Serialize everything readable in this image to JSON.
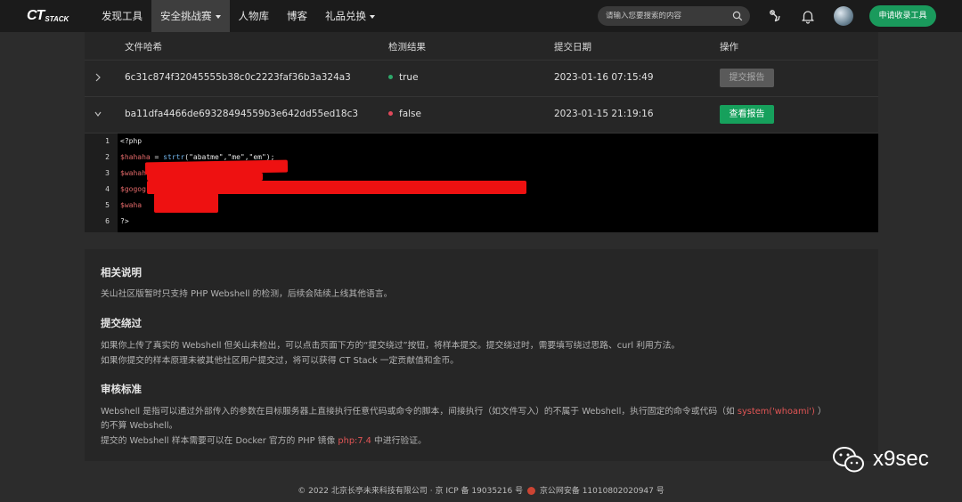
{
  "brand": {
    "mark": "CT",
    "sub": "STACK"
  },
  "nav": [
    {
      "label": "发现工具",
      "active": false,
      "dropdown": false
    },
    {
      "label": "安全挑战赛",
      "active": true,
      "dropdown": true
    },
    {
      "label": "人物库",
      "active": false,
      "dropdown": false
    },
    {
      "label": "博客",
      "active": false,
      "dropdown": false
    },
    {
      "label": "礼品兑换",
      "active": false,
      "dropdown": true
    }
  ],
  "search": {
    "placeholder": "请输入您要搜索的内容"
  },
  "header": {
    "apply_button": "申请收录工具"
  },
  "table": {
    "columns": [
      "文件哈希",
      "检测结果",
      "提交日期",
      "操作"
    ],
    "rows": [
      {
        "hash": "6c31c874f32045555b38c0c2223faf36b3a324a3",
        "result": "true",
        "result_color": "#2ea86a",
        "date": "2023-01-16 07:15:49",
        "action": "提交报告",
        "expanded": false
      },
      {
        "hash": "ba11dfa4466de69328494559b3e642dd55ed18c3",
        "result": "false",
        "result_color": "#e0485a",
        "date": "2023-01-15 21:19:16",
        "action": "查看报告",
        "expanded": true
      }
    ]
  },
  "code": {
    "line_numbers": [
      "1",
      "2",
      "3",
      "4",
      "5",
      "6"
    ],
    "line1": "<?php",
    "line2_var": "$hahaha",
    "line2_eq": " = ",
    "line2_fn": "strtr",
    "line2_args": "(\"abatme\",\"me\",\"em\");",
    "line3_visible": "$wahah",
    "line4_visible": "$gogog",
    "line5_visible": "$waha",
    "line6": "?>"
  },
  "info": {
    "sections": [
      {
        "title": "相关说明",
        "lines": [
          "关山社区版暂时只支持 PHP Webshell 的检测，后续会陆续上线其他语言。"
        ]
      },
      {
        "title": "提交绕过",
        "lines": [
          "如果你上传了真实的 Webshell 但关山未检出，可以点击页面下方的“提交绕过”按钮，将样本提交。提交绕过时，需要填写绕过思路、curl 利用方法。",
          "如果你提交的样本原理未被其他社区用户提交过，将可以获得 CT Stack 一定贡献值和金币。"
        ]
      },
      {
        "title": "审核标准"
      }
    ],
    "criteria_line1_a": "Webshell 是指可以通过外部传入的参数在目标服务器上直接执行任意代码或命令的脚本，间接执行（如文件写入）的不属于 Webshell，执行固定的命令或代码（如 ",
    "criteria_line1_code": "system('whoami')",
    "criteria_line1_b": " ）",
    "criteria_line2": "的不算 Webshell。",
    "criteria_line3_a": "提交的 Webshell 样本需要可以在 Docker 官方的 PHP 镜像 ",
    "criteria_line3_code": "php:7.4",
    "criteria_line3_b": " 中进行验证。"
  },
  "footer": {
    "left": "© 2022 北京长亭未来科技有限公司 · 京 ICP 备 19035216 号",
    "right": "京公网安备 11010802020947 号"
  },
  "watermark": {
    "text": "x9sec"
  },
  "colors": {
    "accent": "#1a9a5c",
    "danger": "#e0485a",
    "highlight": "#e25555"
  }
}
